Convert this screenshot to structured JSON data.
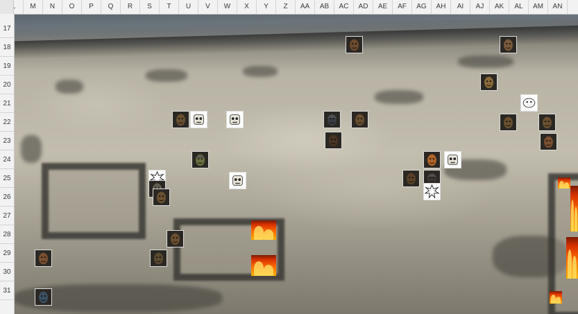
{
  "sheet": {
    "columns": [
      "L",
      "M",
      "N",
      "O",
      "P",
      "Q",
      "R",
      "S",
      "T",
      "U",
      "V",
      "W",
      "X",
      "Y",
      "Z",
      "AA",
      "AB",
      "AC",
      "AD",
      "AE",
      "AF",
      "AG",
      "AH",
      "AI",
      "AJ",
      "AK",
      "AL",
      "AM",
      "AN"
    ],
    "rows": [
      "17",
      "18",
      "19",
      "20",
      "21",
      "22",
      "23",
      "24",
      "25",
      "26",
      "27",
      "28",
      "29",
      "30",
      "31"
    ]
  },
  "map": {
    "palette": {
      "terrain": "#b8b3a5",
      "shadow": "#3b3935",
      "sky": "#4a5660",
      "fire": "#ff6a00"
    },
    "tokens": [
      {
        "name": "token-bearded-man",
        "kind": "human",
        "color": "#6b4a2e"
      },
      {
        "name": "token-orc-brute",
        "kind": "orc",
        "color": "#7a5a3a"
      },
      {
        "name": "token-kobold",
        "kind": "reptile",
        "color": "#8a6a3a"
      },
      {
        "name": "token-lizard-warrior",
        "kind": "reptile",
        "color": "#6a5030"
      },
      {
        "name": "token-skull-mask-1",
        "kind": "skull",
        "color": "#e8e4d8"
      },
      {
        "name": "token-skull-mask-2",
        "kind": "skull",
        "color": "#e8e4d8"
      },
      {
        "name": "token-dark-knight",
        "kind": "armored",
        "color": "#3a3c44"
      },
      {
        "name": "token-lizard-2",
        "kind": "reptile",
        "color": "#6a5030"
      },
      {
        "name": "token-ghost-sketch",
        "kind": "sketch",
        "color": "#f4f4f4"
      },
      {
        "name": "token-lizard-3",
        "kind": "reptile",
        "color": "#6a5030"
      },
      {
        "name": "token-lizard-4",
        "kind": "reptile",
        "color": "#6a5030"
      },
      {
        "name": "token-dark-haired-man",
        "kind": "human",
        "color": "#4a3424"
      },
      {
        "name": "token-hooded-woman",
        "kind": "human",
        "color": "#7a5030"
      },
      {
        "name": "token-green-helmet",
        "kind": "soldier",
        "color": "#6a7040"
      },
      {
        "name": "token-orange-orc",
        "kind": "orc",
        "color": "#b0652a"
      },
      {
        "name": "token-skull-mask-3",
        "kind": "skull",
        "color": "#e8e4d8"
      },
      {
        "name": "token-pow-burst-1",
        "kind": "burst",
        "color": "#ffffff"
      },
      {
        "name": "token-helmet-soldier",
        "kind": "soldier",
        "color": "#7a7050"
      },
      {
        "name": "token-skull-mask-4",
        "kind": "skull",
        "color": "#e8e4d8"
      },
      {
        "name": "token-bearded-dwarf",
        "kind": "dwarf",
        "color": "#5a4028"
      },
      {
        "name": "token-dark-warrior",
        "kind": "armored",
        "color": "#3a3530"
      },
      {
        "name": "token-pow-burst-2",
        "kind": "burst",
        "color": "#ffffff"
      },
      {
        "name": "token-lizard-5",
        "kind": "reptile",
        "color": "#6a5030"
      },
      {
        "name": "token-lizard-6",
        "kind": "reptile",
        "color": "#6a5030"
      },
      {
        "name": "token-lizard-7",
        "kind": "reptile",
        "color": "#5a4a30"
      },
      {
        "name": "token-young-man",
        "kind": "human",
        "color": "#7a5030"
      },
      {
        "name": "token-blue-creature",
        "kind": "creature",
        "color": "#3a5060"
      }
    ],
    "fires": [
      "fire-1",
      "fire-2",
      "fire-3",
      "fire-4",
      "fire-5",
      "fire-6"
    ]
  }
}
